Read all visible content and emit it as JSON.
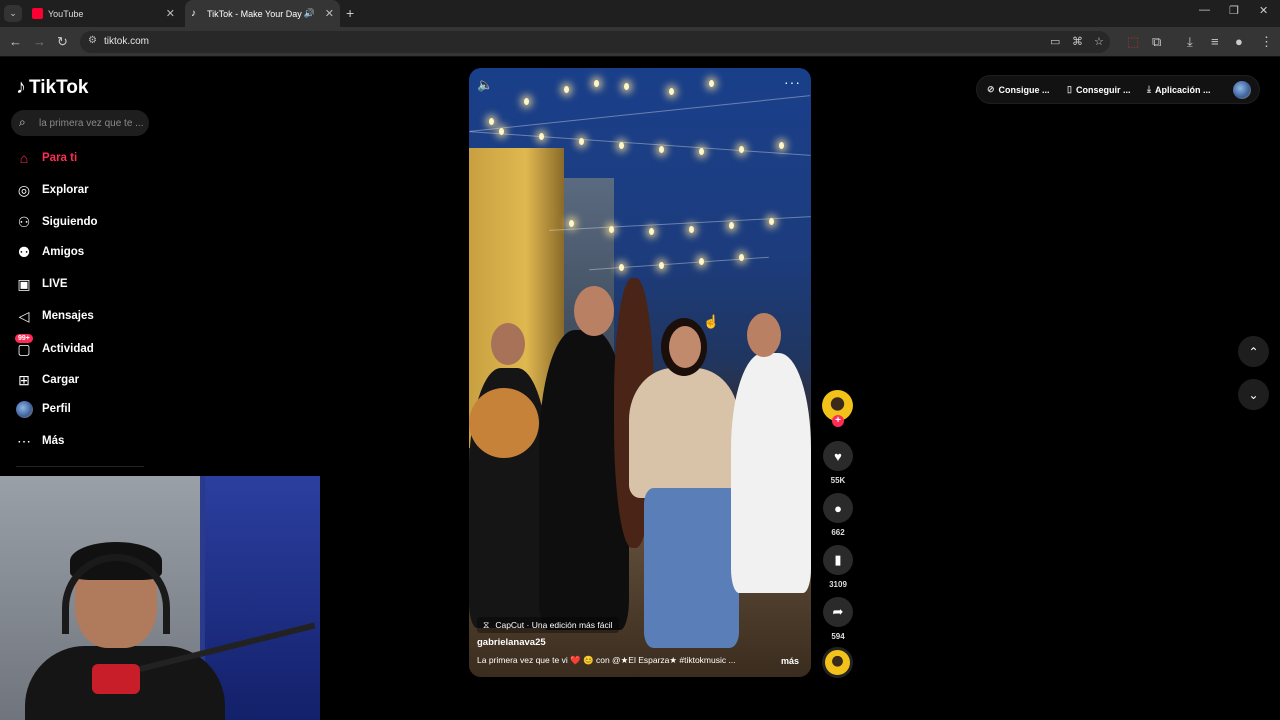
{
  "browser": {
    "tabs": [
      {
        "title": "YouTube",
        "favicon_color": "#ff0033"
      },
      {
        "title": "TikTok - Make Your Day",
        "favicon_color": "#ffffff",
        "active": true
      }
    ],
    "url": "tiktok.com"
  },
  "app": {
    "name": "TikTok"
  },
  "search": {
    "placeholder": "la primera vez que te ..."
  },
  "sidebar": {
    "items": [
      {
        "label": "Para ti",
        "icon": "home-icon"
      },
      {
        "label": "Explorar",
        "icon": "compass-icon"
      },
      {
        "label": "Siguiendo",
        "icon": "following-icon"
      },
      {
        "label": "Amigos",
        "icon": "friends-icon"
      },
      {
        "label": "LIVE",
        "icon": "live-icon"
      },
      {
        "label": "Mensajes",
        "icon": "send-icon"
      },
      {
        "label": "Actividad",
        "icon": "activity-icon",
        "badge": "99+"
      },
      {
        "label": "Cargar",
        "icon": "upload-icon"
      },
      {
        "label": "Perfil",
        "icon": "avatar"
      },
      {
        "label": "Más",
        "icon": "more-icon"
      }
    ]
  },
  "topbar": {
    "coins": "Consigue ...",
    "get_app": "Conseguir ...",
    "download": "Aplicación ..."
  },
  "video": {
    "capcut_label": "CapCut · Una edición más fácil",
    "username": "gabrielanava25",
    "caption": "La primera vez que te vi ❤️ 😊 con @★El Esparza★ #tiktokmusic ...",
    "more_label": "más"
  },
  "actions": {
    "likes": "55K",
    "comments": "662",
    "saves": "3109",
    "shares": "594"
  },
  "colors": {
    "accent": "#fe2c55",
    "background": "#000000"
  }
}
